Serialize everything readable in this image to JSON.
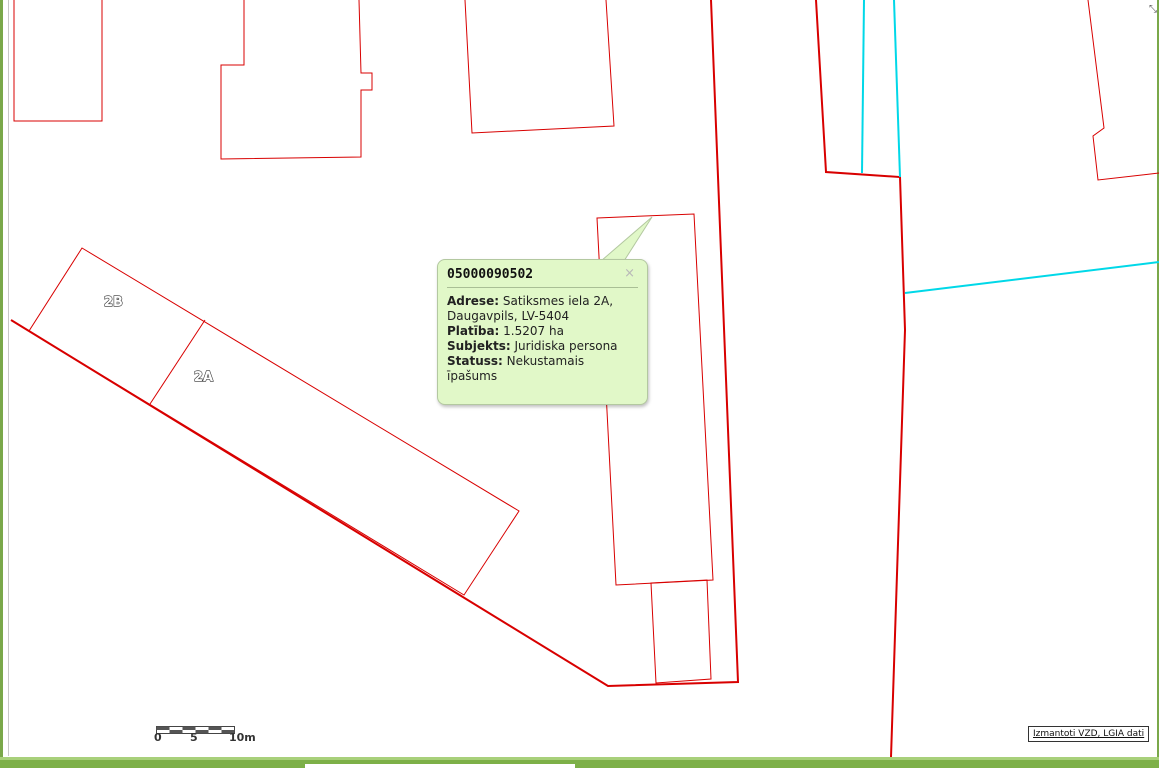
{
  "map": {
    "parcel_labels": [
      "2B",
      "2A"
    ],
    "colors": {
      "parcel_boundary": "#d80000",
      "cyan_boundary": "#00d8e8",
      "frame": "#7aa84a",
      "popup_background": "#e1f8c8"
    }
  },
  "popup": {
    "title": "05000090502",
    "close_glyph": "×",
    "rows": [
      {
        "key": "Adrese:",
        "value": "Satiksmes iela 2A, Daugavpils, LV-5404"
      },
      {
        "key": "Platība:",
        "value": "1.5207 ha"
      },
      {
        "key": "Subjekts:",
        "value": "Juridiska persona"
      },
      {
        "key": "Statuss:",
        "value": "Nekustamais īpašums"
      }
    ]
  },
  "scale": {
    "labels": [
      "0",
      "5",
      "10m"
    ]
  },
  "attribution": {
    "text": "Izmantoti VZD, LGIA dati"
  },
  "corner_control": {
    "icon": "expand-icon",
    "glyph": "⤡"
  }
}
